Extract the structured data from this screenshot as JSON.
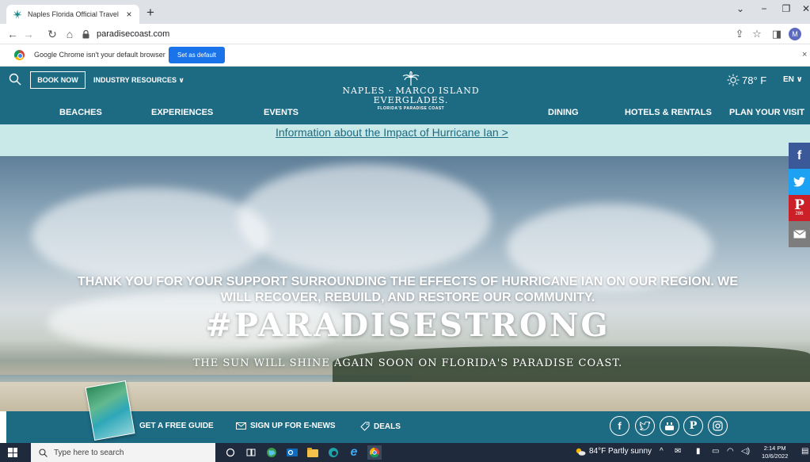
{
  "browser": {
    "tab_title": "Naples Florida Official Travel Web",
    "tab_close": "×",
    "new_tab": "+",
    "url": "paradisecoast.com",
    "profile_initial": "M",
    "nav_icons": [
      "back-icon",
      "forward-icon",
      "reload-icon",
      "home-icon"
    ],
    "window_controls": [
      "chevron-down-icon",
      "minimize-icon",
      "maximize-icon",
      "close-icon"
    ]
  },
  "infobar": {
    "message": "Google Chrome isn't your default browser",
    "button": "Set as default",
    "close": "×"
  },
  "header": {
    "book_now": "BOOK NOW",
    "industry": "INDUSTRY RESOURCES ∨",
    "logo": {
      "line1": "NAPLES · MARCO ISLAND",
      "line2": "EVERGLADES.",
      "line3": "FLORIDA'S PARADISE COAST"
    },
    "weather": "78° F",
    "language": "EN ∨",
    "menu": [
      "BEACHES",
      "EXPERIENCES",
      "EVENTS",
      "DINING",
      "HOTELS & RENTALS",
      "PLAN YOUR VISIT"
    ]
  },
  "alert": {
    "link": "Information about the Impact of Hurricane Ian >"
  },
  "hero": {
    "message": "THANK YOU FOR YOUR SUPPORT SURROUNDING THE EFFECTS OF HURRICANE IAN ON OUR REGION. WE WILL RECOVER, REBUILD, AND RESTORE OUR COMMUNITY.",
    "hashtag": "#PARADISESTRONG",
    "subtitle": "THE SUN WILL SHINE AGAIN SOON ON FLORIDA'S PARADISE COAST."
  },
  "social_side": {
    "pinterest_count": "286",
    "items": [
      "facebook-icon",
      "twitter-icon",
      "pinterest-icon",
      "email-icon"
    ],
    "colors": {
      "facebook": "#3b5998",
      "twitter": "#1da1f2",
      "pinterest": "#cb2027",
      "email": "#7d7d7d"
    }
  },
  "footer": {
    "guide": "GET A FREE GUIDE",
    "enews": "SIGN UP FOR E-NEWS",
    "deals": "DEALS",
    "social": [
      "facebook-icon",
      "twitter-icon",
      "youtube-icon",
      "pinterest-icon",
      "instagram-icon"
    ]
  },
  "taskbar": {
    "search_placeholder": "Type here to search",
    "weather": "84°F  Partly sunny",
    "time": "2:14 PM",
    "date": "10/6/2022"
  },
  "colors": {
    "brand": "#1d6a83",
    "alert_bg": "#c8e9e7",
    "chrome_button": "#1a73e8",
    "taskbar": "#1f2b3d"
  }
}
